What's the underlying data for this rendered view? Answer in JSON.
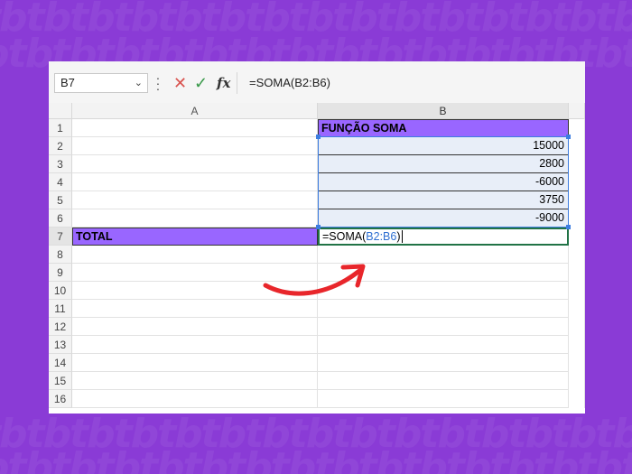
{
  "formula_bar": {
    "name_box": "B7",
    "formula": "=SOMA(B2:B6)",
    "fx_label": "fx",
    "cancel_glyph": "✕",
    "enter_glyph": "✓"
  },
  "columns": [
    "A",
    "B"
  ],
  "rows": [
    "1",
    "2",
    "3",
    "4",
    "5",
    "6",
    "7",
    "8",
    "9",
    "10",
    "11",
    "12",
    "13",
    "14",
    "15",
    "16"
  ],
  "cells": {
    "B1": "FUNÇÃO SOMA",
    "B2": "15000",
    "B3": "2800",
    "B4": "-6000",
    "B5": "3750",
    "B6": "-9000",
    "A7": "TOTAL",
    "B7_prefix": "=SOMA(",
    "B7_ref": "B2:B6",
    "B7_suffix": ")"
  },
  "colors": {
    "background": "#8a3bd6",
    "highlight": "#9966ff",
    "range_border": "#3d7de0",
    "arrow": "#e8262b"
  },
  "icons": {
    "cancel": "close-icon",
    "enter": "check-icon",
    "function": "fx-icon",
    "dropdown": "chevron-down-icon",
    "annotation": "curved-arrow-icon"
  }
}
